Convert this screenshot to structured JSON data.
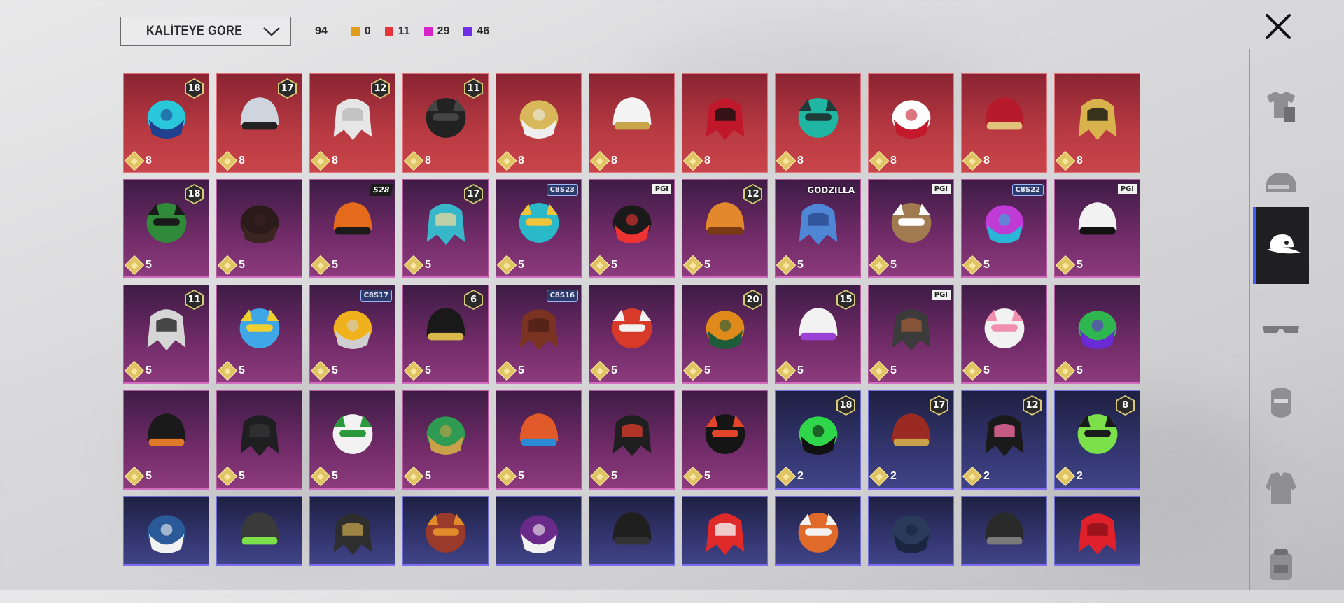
{
  "toolbar": {
    "sort_label": "KALİTEYE GÖRE",
    "total_count": "94",
    "counts": [
      {
        "color": "#e39b1b",
        "value": "0"
      },
      {
        "color": "#e8333a",
        "value": "11"
      },
      {
        "color": "#d623c8",
        "value": "29"
      },
      {
        "color": "#6f2ee6",
        "value": "46"
      }
    ]
  },
  "sidebar": {
    "categories": [
      {
        "icon": "outfit-icon",
        "active": false
      },
      {
        "icon": "helmet-icon",
        "active": false
      },
      {
        "icon": "cap-icon",
        "active": true
      },
      {
        "icon": "glasses-icon",
        "active": false
      },
      {
        "icon": "mask-icon",
        "active": false
      },
      {
        "icon": "jacket-icon",
        "active": false
      },
      {
        "icon": "backpack-icon",
        "active": false
      }
    ]
  },
  "items": [
    {
      "rarity": "red",
      "badge": "18",
      "price": "8",
      "icon": "blue-dragon-helmet-icon",
      "c1": "#2ac6d9",
      "c2": "#1f3f8f"
    },
    {
      "rarity": "red",
      "badge": "17",
      "price": "8",
      "icon": "horned-mask-icon",
      "c1": "#cfd5de",
      "c2": "#222"
    },
    {
      "rarity": "red",
      "badge": "12",
      "price": "8",
      "icon": "white-hair-icon",
      "c1": "#e6e6e6",
      "c2": "#b9b9b9"
    },
    {
      "rarity": "red",
      "badge": "11",
      "price": "8",
      "icon": "black-hair-icon",
      "c1": "#222",
      "c2": "#444"
    },
    {
      "rarity": "red",
      "badge": "",
      "price": "8",
      "icon": "blonde-hair-mask-icon",
      "c1": "#d8b85a",
      "c2": "#eee"
    },
    {
      "rarity": "red",
      "badge": "",
      "price": "8",
      "icon": "white-cowboy-hat-icon",
      "c1": "#f4f4f4",
      "c2": "#c8a44a"
    },
    {
      "rarity": "red",
      "badge": "",
      "price": "8",
      "icon": "red-black-helmet-icon",
      "c1": "#c0182a",
      "c2": "#111"
    },
    {
      "rarity": "red",
      "badge": "",
      "price": "8",
      "icon": "green-teal-helmet-icon",
      "c1": "#1fb6a4",
      "c2": "#1e3b3a"
    },
    {
      "rarity": "red",
      "badge": "",
      "price": "8",
      "icon": "red-horn-helmet-icon",
      "c1": "#ffffff",
      "c2": "#c3192b"
    },
    {
      "rarity": "red",
      "badge": "",
      "price": "8",
      "icon": "red-gold-helmet-icon",
      "c1": "#b71a2a",
      "c2": "#e0c27a"
    },
    {
      "rarity": "red",
      "badge": "",
      "price": "8",
      "icon": "gold-black-armor-helmet-icon",
      "c1": "#d7b24d",
      "c2": "#111"
    },
    {
      "rarity": "purple",
      "badge": "18",
      "price": "5",
      "icon": "green-bandana-icon",
      "c1": "#2f8a3a",
      "c2": "#1a1a1a"
    },
    {
      "rarity": "purple",
      "badge": "",
      "price": "5",
      "icon": "long-dark-hair-icon",
      "c1": "#2a1a1a",
      "c2": "#3b2522"
    },
    {
      "rarity": "purple",
      "badge": "",
      "tag": "S28",
      "tagStyle": "dark",
      "price": "5",
      "icon": "orange-crown-hat-icon",
      "c1": "#e66a1c",
      "c2": "#1b1b1b"
    },
    {
      "rarity": "purple",
      "badge": "17",
      "price": "5",
      "icon": "teal-cap-hair-icon",
      "c1": "#37b7c9",
      "c2": "#e0d6a0"
    },
    {
      "rarity": "purple",
      "badge": "",
      "tag": "C8S23",
      "tagStyle": "season",
      "price": "5",
      "icon": "cat-ear-headphones-icon",
      "c1": "#2ab9c9",
      "c2": "#f1c33a"
    },
    {
      "rarity": "purple",
      "badge": "",
      "tag": "PGI",
      "tagStyle": "light",
      "price": "5",
      "icon": "black-cap-icon",
      "c1": "#1a1a1a",
      "c2": "#e33"
    },
    {
      "rarity": "purple",
      "badge": "12",
      "price": "5",
      "icon": "orange-pigtails-icon",
      "c1": "#e2892e",
      "c2": "#7b3b12"
    },
    {
      "rarity": "purple",
      "badge": "",
      "tag": "GODZILLA",
      "tagStyle": "white-text",
      "price": "5",
      "icon": "blue-hair-icon",
      "c1": "#4f86d6",
      "c2": "#2b4a8f"
    },
    {
      "rarity": "purple",
      "badge": "",
      "tag": "PGI",
      "tagStyle": "light",
      "price": "5",
      "icon": "llama-head-icon",
      "c1": "#a27a4f",
      "c2": "#fff"
    },
    {
      "rarity": "purple",
      "badge": "",
      "tag": "C8S22",
      "tagStyle": "season",
      "price": "5",
      "icon": "purple-bob-hair-icon",
      "c1": "#c03ad6",
      "c2": "#2ab6d6"
    },
    {
      "rarity": "purple",
      "badge": "",
      "tag": "PGI",
      "tagStyle": "light",
      "price": "5",
      "icon": "panda-head-icon",
      "c1": "#f2f2f2",
      "c2": "#111"
    },
    {
      "rarity": "purple",
      "badge": "11",
      "price": "5",
      "icon": "flower-veil-icon",
      "c1": "#d6d6d6",
      "c2": "#222"
    },
    {
      "rarity": "purple",
      "badge": "",
      "price": "5",
      "icon": "blue-bird-icon",
      "c1": "#3fa6e8",
      "c2": "#f0d030"
    },
    {
      "rarity": "purple",
      "badge": "",
      "tag": "C8S17",
      "tagStyle": "season",
      "price": "5",
      "icon": "yellow-visor-hair-icon",
      "c1": "#f0b21c",
      "c2": "#cfcfcf"
    },
    {
      "rarity": "purple",
      "badge": "6",
      "price": "5",
      "icon": "black-gold-mask-icon",
      "c1": "#191919",
      "c2": "#d9b84b"
    },
    {
      "rarity": "purple",
      "badge": "",
      "tag": "C8S16",
      "tagStyle": "season",
      "price": "5",
      "icon": "brown-short-hair-icon",
      "c1": "#7a3322",
      "c2": "#4d1f18"
    },
    {
      "rarity": "purple",
      "badge": "",
      "price": "5",
      "icon": "red-oni-mask-icon",
      "c1": "#d83a2a",
      "c2": "#f2f2f2"
    },
    {
      "rarity": "purple",
      "badge": "20",
      "price": "5",
      "icon": "tribal-mask-icon",
      "c1": "#e08a1c",
      "c2": "#1e5b3a"
    },
    {
      "rarity": "purple",
      "badge": "15",
      "price": "5",
      "icon": "purple-bird-mask-icon",
      "c1": "#f2f2f2",
      "c2": "#9a42d6"
    },
    {
      "rarity": "purple",
      "badge": "",
      "tag": "PGI",
      "tagStyle": "light",
      "price": "5",
      "icon": "gas-mask-hood-icon",
      "c1": "#3b3b3b",
      "c2": "#9a5a3a"
    },
    {
      "rarity": "purple",
      "badge": "",
      "price": "5",
      "icon": "bunny-hood-icon",
      "c1": "#f2f2f2",
      "c2": "#f08fb0"
    },
    {
      "rarity": "purple",
      "badge": "",
      "price": "5",
      "icon": "green-purple-helmet-icon",
      "c1": "#2fb64f",
      "c2": "#6a2ad6"
    },
    {
      "rarity": "purple",
      "badge": "",
      "price": "5",
      "icon": "black-top-hat-icon",
      "c1": "#1a1a1a",
      "c2": "#e0782a"
    },
    {
      "rarity": "purple",
      "badge": "",
      "price": "5",
      "icon": "black-ski-mask-icon",
      "c1": "#1f1f22",
      "c2": "#333"
    },
    {
      "rarity": "purple",
      "badge": "",
      "price": "5",
      "icon": "snowman-hat-icon",
      "c1": "#f2f2f2",
      "c2": "#2b9a3c"
    },
    {
      "rarity": "purple",
      "badge": "",
      "price": "5",
      "icon": "spike-helmet-icon",
      "c1": "#2f9a52",
      "c2": "#c8a14a"
    },
    {
      "rarity": "purple",
      "badge": "",
      "price": "5",
      "icon": "feather-headband-icon",
      "c1": "#e05a2a",
      "c2": "#2b8ad6"
    },
    {
      "rarity": "purple",
      "badge": "",
      "price": "5",
      "icon": "black-fedora-icon",
      "c1": "#1f1f1f",
      "c2": "#d63a2a"
    },
    {
      "rarity": "purple",
      "badge": "",
      "price": "5",
      "icon": "black-red-helmet-icon",
      "c1": "#151515",
      "c2": "#e0452a"
    },
    {
      "rarity": "blue",
      "badge": "18",
      "price": "2",
      "icon": "green-beanie-icon",
      "c1": "#2fd64a",
      "c2": "#111"
    },
    {
      "rarity": "blue",
      "badge": "17",
      "price": "2",
      "icon": "spiked-red-hair-icon",
      "c1": "#9a2a22",
      "c2": "#c8a14a"
    },
    {
      "rarity": "blue",
      "badge": "12",
      "price": "2",
      "icon": "bunny-ear-cap-icon",
      "c1": "#1a1a1a",
      "c2": "#f06aa0"
    },
    {
      "rarity": "blue",
      "badge": "8",
      "price": "2",
      "icon": "green-skull-hair-icon",
      "c1": "#7be04a",
      "c2": "#1a1a1a"
    },
    {
      "rarity": "blue",
      "badge": "",
      "price": "",
      "icon": "blue-baseball-cap-icon",
      "c1": "#2a5a9a",
      "c2": "#f2f2f2"
    },
    {
      "rarity": "blue",
      "badge": "",
      "price": "",
      "icon": "green-goggle-helmet-icon",
      "c1": "#3a3a3a",
      "c2": "#7be04a"
    },
    {
      "rarity": "blue",
      "badge": "",
      "price": "",
      "icon": "tan-visor-helmet-icon",
      "c1": "#2e2e2e",
      "c2": "#b89a4a"
    },
    {
      "rarity": "blue",
      "badge": "",
      "price": "",
      "icon": "red-hair-goggles-icon",
      "c1": "#9a3a2a",
      "c2": "#e08a2a"
    },
    {
      "rarity": "blue",
      "badge": "",
      "price": "",
      "icon": "purple-hood-goggles-icon",
      "c1": "#6a2a8a",
      "c2": "#f2f2f2"
    },
    {
      "rarity": "blue",
      "badge": "",
      "price": "",
      "icon": "black-flat-cap-icon",
      "c1": "#1f1f1f",
      "c2": "#333"
    },
    {
      "rarity": "blue",
      "badge": "",
      "price": "",
      "icon": "red-white-cap-icon",
      "c1": "#e02a2a",
      "c2": "#f2f2f2"
    },
    {
      "rarity": "blue",
      "badge": "",
      "price": "",
      "icon": "orange-cat-ears-icon",
      "c1": "#e06a2a",
      "c2": "#f2f2f2"
    },
    {
      "rarity": "blue",
      "badge": "",
      "price": "",
      "icon": "navy-beanie-icon",
      "c1": "#2a3a5a",
      "c2": "#1a2540"
    },
    {
      "rarity": "blue",
      "badge": "",
      "price": "",
      "icon": "headset-helmet-icon",
      "c1": "#2a2a2a",
      "c2": "#7a7a7a"
    },
    {
      "rarity": "blue",
      "badge": "",
      "price": "",
      "icon": "red-mohawk-icon",
      "c1": "#e0202a",
      "c2": "#8a1018"
    }
  ]
}
